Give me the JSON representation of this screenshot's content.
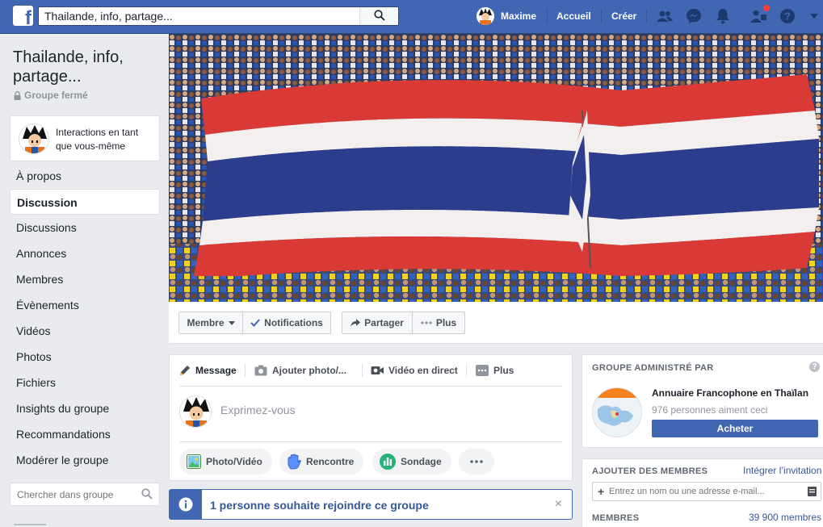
{
  "colors": {
    "brand": "#4267b2",
    "link": "#365899",
    "bg": "#e9ebee"
  },
  "topbar": {
    "logo": "f",
    "search_value": "Thailande, info, partage...",
    "search_icon": "search-icon",
    "user_name": "Maxime",
    "home_label": "Accueil",
    "create_label": "Créer",
    "icons": [
      "friends-icon",
      "messenger-icon",
      "bell-icon",
      "group-requests-icon",
      "help-icon",
      "caret-down-icon"
    ]
  },
  "sidebar": {
    "group_name": "Thailande, info, partage...",
    "group_type": "Groupe fermé",
    "interact_text": "Interactions en tant que vous-même",
    "items": [
      {
        "label": "À propos"
      },
      {
        "label": "Discussion"
      },
      {
        "label": "Discussions"
      },
      {
        "label": "Annonces"
      },
      {
        "label": "Membres"
      },
      {
        "label": "Évènements"
      },
      {
        "label": "Vidéos"
      },
      {
        "label": "Photos"
      },
      {
        "label": "Fichiers"
      },
      {
        "label": "Insights du groupe"
      },
      {
        "label": "Recommandations"
      },
      {
        "label": "Modérer le groupe"
      }
    ],
    "active_index": 1,
    "search_placeholder": "Chercher dans groupe"
  },
  "cover_actions": {
    "membre": "Membre",
    "notifications": "Notifications",
    "partager": "Partager",
    "plus": "Plus"
  },
  "composer": {
    "tabs": {
      "message": "Message",
      "photo": "Ajouter photo/...",
      "video": "Vidéo en direct",
      "plus": "Plus"
    },
    "placeholder": "Exprimez-vous",
    "actions": {
      "photo_video": "Photo/Vidéo",
      "rencontre": "Rencontre",
      "sondage": "Sondage"
    }
  },
  "join_request": {
    "text": "1 personne souhaite rejoindre ce groupe",
    "close": "×"
  },
  "admin_card": {
    "heading": "GROUPE ADMINISTRÉ PAR",
    "page_name": "Annuaire Francophone en Thaïlan",
    "likes": "976 personnes aiment ceci",
    "buy_label": "Acheter",
    "help": "?"
  },
  "add_members": {
    "heading": "AJOUTER DES MEMBRES",
    "invite_link": "Intégrer l’invitation",
    "input_placeholder": "Entrez un nom ou une adresse e-mail...",
    "members_heading": "MEMBRES",
    "members_count": "39 900 membres"
  }
}
